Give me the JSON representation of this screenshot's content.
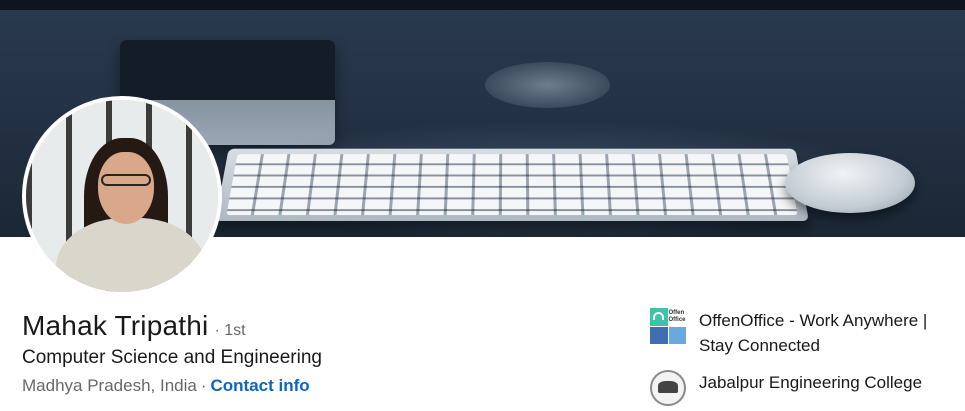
{
  "profile": {
    "name": "Mahak Tripathi",
    "degree": "· 1st",
    "headline": "Computer Science and Engineering",
    "location": "Madhya Pradesh, India",
    "separator": "·",
    "contact_info": "Contact info"
  },
  "experience": {
    "company": "OffenOffice - Work Anywhere | Stay Connected",
    "company_logo_text": "Offen Office",
    "school": "Jabalpur Engineering College"
  },
  "colors": {
    "link": "#0a66c2",
    "banner": "#233244"
  },
  "icons": {
    "avatar": "profile-photo",
    "company": "company-logo",
    "school": "school-logo"
  }
}
